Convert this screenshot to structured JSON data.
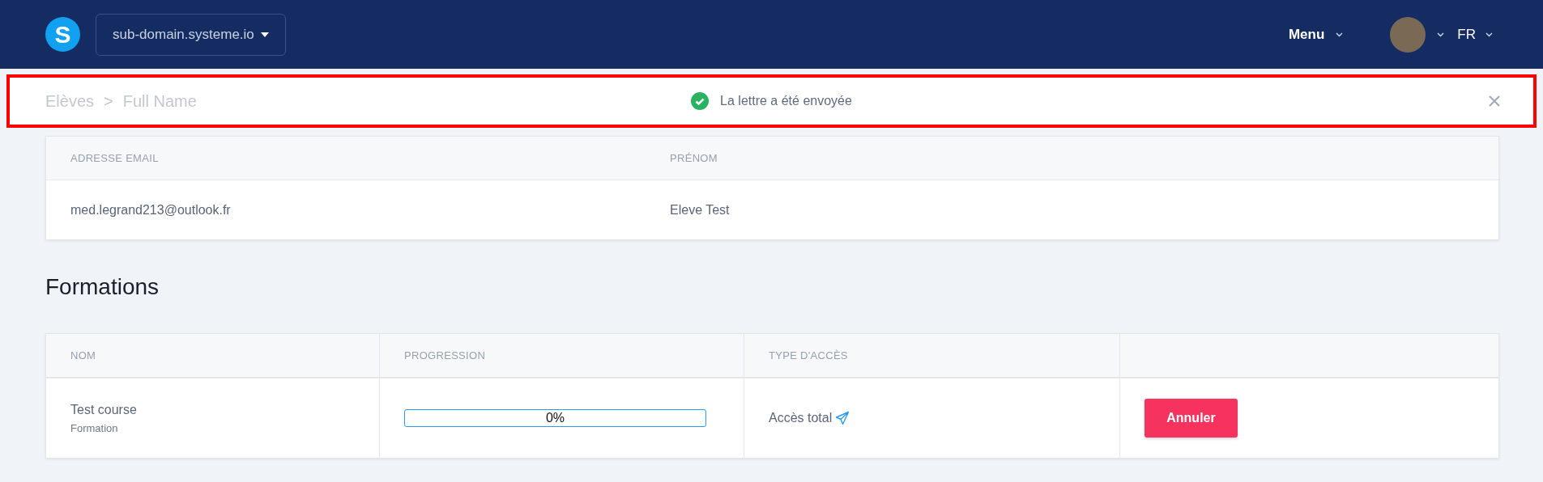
{
  "header": {
    "logo": "S",
    "domain": "sub-domain.systeme.io",
    "menu": "Menu",
    "language": "FR"
  },
  "breadcrumb": {
    "items": [
      "Elèves",
      "Full Name"
    ],
    "separator": ">"
  },
  "notification": {
    "message": "La lettre a été envoyée"
  },
  "contact": {
    "columns": [
      "ADRESSE EMAIL",
      "PRÉNOM"
    ],
    "values": [
      "med.legrand213@outlook.fr",
      "Eleve Test"
    ]
  },
  "section_title": "Formations",
  "courses": {
    "columns": [
      "NOM",
      "PROGRESSION",
      "TYPE D'ACCÈS"
    ],
    "rows": [
      {
        "name": "Test course",
        "type": "Formation",
        "level": 0,
        "progress": "0%",
        "access": "Accès total",
        "action": "Annuler"
      }
    ]
  }
}
